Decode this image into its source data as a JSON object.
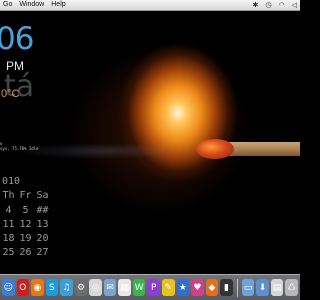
{
  "menubar": {
    "items": [
      "Go",
      "Window",
      "Help"
    ]
  },
  "tray": {
    "icons": [
      "bluetooth-icon",
      "time-machine-icon",
      "wifi-icon",
      "volume-icon"
    ]
  },
  "widgets": {
    "clock_time": "06",
    "clock_ampm": "PM",
    "weather_ghost": "tá",
    "weather_temp": "0°C",
    "sys_line_1": "o",
    "sys_line_2": "sys, 75.70% Idle"
  },
  "calendar": {
    "year": "010",
    "weekday_headers": [
      "Th",
      "Fr",
      "Sa"
    ],
    "weeks": [
      [
        "4",
        "5",
        "##"
      ],
      [
        "11",
        "12",
        "13"
      ],
      [
        "18",
        "19",
        "20"
      ],
      [
        "25",
        "26",
        "27"
      ]
    ]
  },
  "dock": {
    "apps": [
      {
        "name": "finder",
        "color": "#3a7fd0",
        "glyph": "☺"
      },
      {
        "name": "opera",
        "color": "#cc1f1f",
        "glyph": "O"
      },
      {
        "name": "firefox",
        "color": "#e07a1d",
        "glyph": "◉"
      },
      {
        "name": "skype",
        "color": "#1d9bd8",
        "glyph": "S"
      },
      {
        "name": "itunes",
        "color": "#3aa0d8",
        "glyph": "♫"
      },
      {
        "name": "system-preferences",
        "color": "#6d6d6d",
        "glyph": "⚙"
      },
      {
        "name": "chrome",
        "color": "#d8d8d8",
        "glyph": "◎"
      },
      {
        "name": "mail",
        "color": "#7aa6cf",
        "glyph": "✉"
      },
      {
        "name": "ical",
        "color": "#e8e8e8",
        "glyph": "▦"
      },
      {
        "name": "app-green",
        "color": "#3bb54a",
        "glyph": "W"
      },
      {
        "name": "app-purple",
        "color": "#8a3fd0",
        "glyph": "P"
      },
      {
        "name": "app-yellow",
        "color": "#e8c21d",
        "glyph": "✎"
      },
      {
        "name": "app-blue",
        "color": "#2e6fd0",
        "glyph": "★"
      },
      {
        "name": "app-pink",
        "color": "#d03f8a",
        "glyph": "♥"
      },
      {
        "name": "app-orange",
        "color": "#e0701d",
        "glyph": "◆"
      },
      {
        "name": "terminal",
        "color": "#333333",
        "glyph": "▮"
      }
    ],
    "stacks": [
      {
        "name": "folder",
        "color": "#6fa4da",
        "glyph": "▭"
      },
      {
        "name": "downloads",
        "color": "#5d8fcf",
        "glyph": "⬇"
      },
      {
        "name": "documents",
        "color": "#d6d6d6",
        "glyph": "▤"
      },
      {
        "name": "trash",
        "color": "#b8b8b8",
        "glyph": "♺"
      }
    ]
  }
}
